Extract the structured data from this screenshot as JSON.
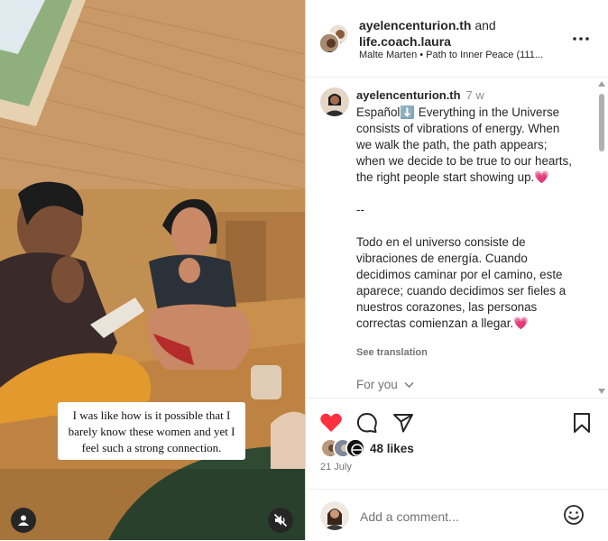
{
  "media": {
    "caption": "I was like how is it possible that I barely know these women and yet I feel such a strong connection."
  },
  "header": {
    "user1": "ayelencenturion.th",
    "joiner": "and",
    "user2": "life.coach.laura",
    "audio": "Malte Marten • Path to Inner Peace (111..."
  },
  "comment": {
    "username": "ayelencenturion.th",
    "time": "7 w",
    "text": "Español⬇️ Everything in the Universe consists of vibrations of energy. When we walk the path, the path appears; when we decide to be true to our hearts, the right people start showing up.💗\n\n--\n\nTodo en el universo consiste de vibraciones de energía. Cuando decidimos caminar por el camino, este aparece; cuando decidimos ser fieles a nuestros corazones, las personas correctas comienzan a llegar.💗",
    "see_translation": "See translation",
    "for_you": "For you"
  },
  "stats": {
    "likes": "48 likes",
    "date": "21 July"
  },
  "composer": {
    "placeholder": "Add a comment..."
  },
  "colors": {
    "like_red": "#ff3040",
    "text": "#262626",
    "muted": "#737373"
  }
}
